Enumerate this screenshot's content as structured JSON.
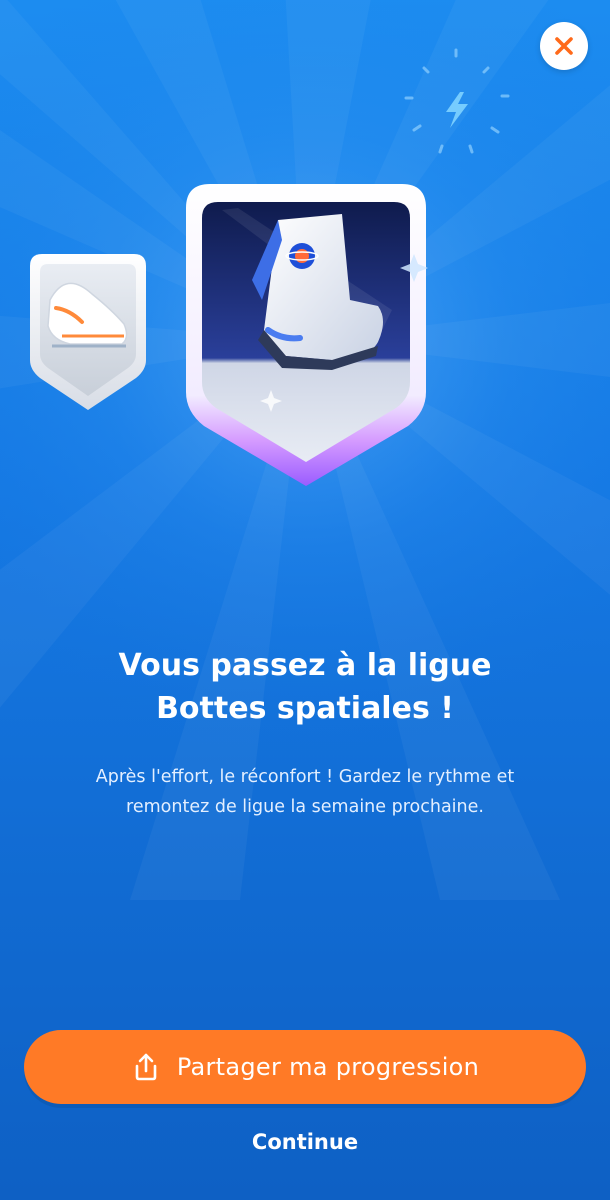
{
  "modal": {
    "title_line1": "Vous passez à la ligue",
    "title_line2": "Bottes spatiales !",
    "subtitle_line1": "Après l'effort, le réconfort ! Gardez le rythme et",
    "subtitle_line2": "remontez de ligue la semaine prochaine."
  },
  "actions": {
    "share_label": "Partager ma progression",
    "continue_label": "Continue",
    "close_icon": "close-icon",
    "share_icon": "share-icon"
  },
  "badges": {
    "previous": {
      "icon": "sneaker-badge"
    },
    "current": {
      "icon": "space-boot-badge"
    }
  },
  "colors": {
    "background_top": "#1c8cf0",
    "background_bottom": "#0e60c4",
    "accent_orange": "#ff7a26",
    "text_white": "#ffffff"
  }
}
